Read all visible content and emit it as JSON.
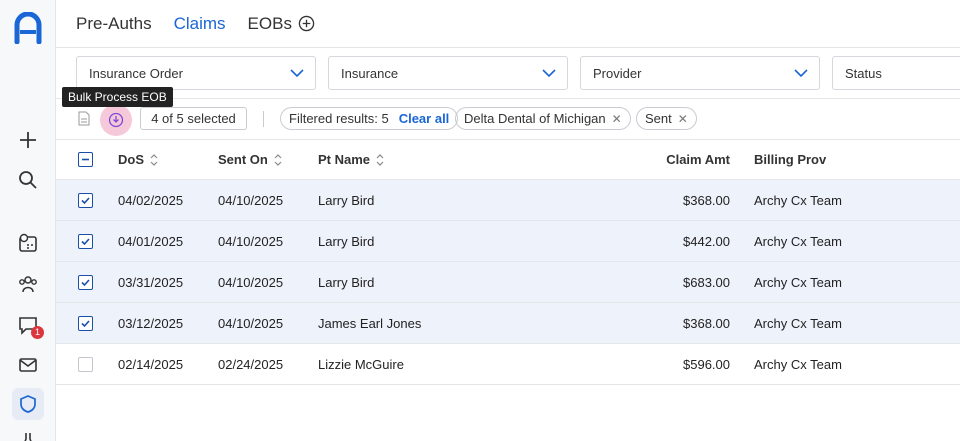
{
  "tabs": [
    {
      "label": "Pre-Auths"
    },
    {
      "label": "Claims"
    },
    {
      "label": "EOBs"
    }
  ],
  "filters": {
    "insurance_order": "Insurance Order",
    "insurance": "Insurance",
    "provider": "Provider",
    "status": "Status"
  },
  "tooltip": "Bulk Process EOB",
  "toolbar": {
    "selected": "4 of 5 selected",
    "filtered": "Filtered results: 5",
    "clear_all": "Clear all",
    "chips": [
      "Delta Dental of Michigan",
      "Sent"
    ]
  },
  "rail": {
    "badge_count": "1"
  },
  "table": {
    "headers": [
      "DoS",
      "Sent On",
      "Pt Name",
      "Claim Amt",
      "Billing Prov"
    ],
    "rows": [
      {
        "dos": "04/02/2025",
        "sent": "04/10/2025",
        "pt": "Larry Bird",
        "amt": "$368.00",
        "bp": "Archy Cx Team",
        "checked": true
      },
      {
        "dos": "04/01/2025",
        "sent": "04/10/2025",
        "pt": "Larry Bird",
        "amt": "$442.00",
        "bp": "Archy Cx Team",
        "checked": true
      },
      {
        "dos": "03/31/2025",
        "sent": "04/10/2025",
        "pt": "Larry Bird",
        "amt": "$683.00",
        "bp": "Archy Cx Team",
        "checked": true
      },
      {
        "dos": "03/12/2025",
        "sent": "04/10/2025",
        "pt": "James Earl Jones",
        "amt": "$368.00",
        "bp": "Archy Cx Team",
        "checked": true
      },
      {
        "dos": "02/14/2025",
        "sent": "02/24/2025",
        "pt": "Lizzie McGuire",
        "amt": "$596.00",
        "bp": "Archy Cx Team",
        "checked": false
      }
    ]
  },
  "colors": {
    "accent": "#1a66d6",
    "selected_row": "#eef2fb",
    "bulk_highlight": "#f6c9da"
  }
}
